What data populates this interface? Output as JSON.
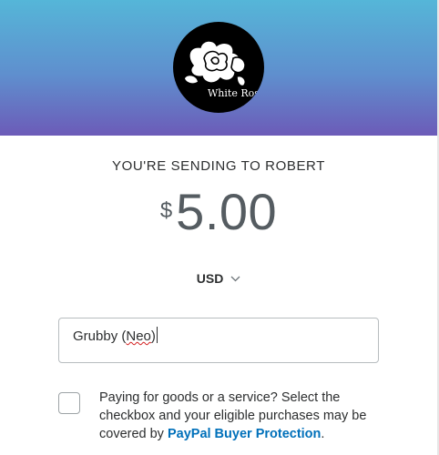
{
  "header": {
    "avatar_icon": "white-rose-logo",
    "logo_text": "White Ros",
    "gradient_colors": [
      "#55b6d8",
      "#6c5bb8"
    ]
  },
  "send": {
    "recipient_text": "YOU'RE SENDING TO ROBERT",
    "currency_symbol": "$",
    "amount": "5.00",
    "currency": "USD",
    "chevron_icon": "chevron-down-icon"
  },
  "note": {
    "value_prefix": "Grubby (",
    "value_misspelled": "Neo",
    "value_suffix": ")"
  },
  "protection": {
    "checked": false,
    "text": "Paying for goods or a service? Select the checkbox and your eligible purchases may be covered by ",
    "link_label": "PayPal Buyer Protection",
    "suffix": ".",
    "link_color": "#0070ba"
  }
}
